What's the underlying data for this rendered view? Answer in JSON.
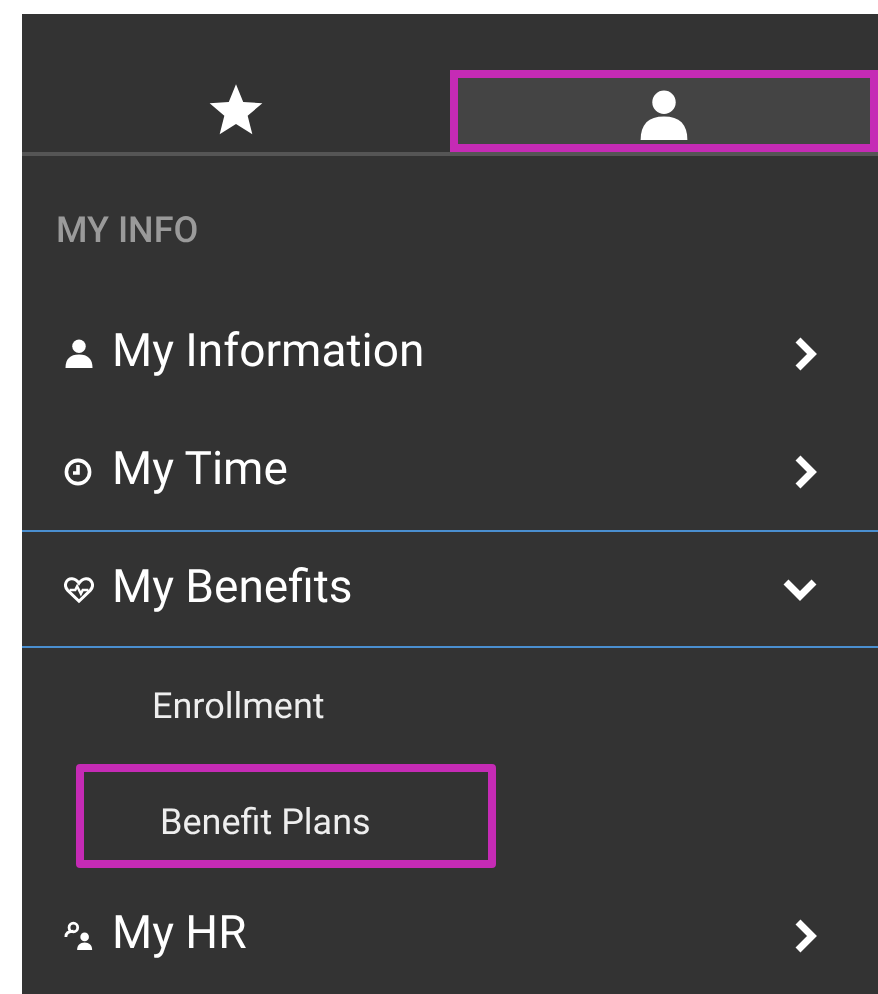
{
  "tabs": [
    {
      "kind": "star",
      "selected": false,
      "highlighted": false
    },
    {
      "kind": "person",
      "selected": true,
      "highlighted": true
    }
  ],
  "section_title": "MY INFO",
  "menu": [
    {
      "label": "My Information",
      "kind": "person",
      "expanded": false
    },
    {
      "label": "My Time",
      "kind": "clock",
      "expanded": false
    },
    {
      "label": "My Benefits",
      "kind": "heart",
      "expanded": true,
      "children": [
        {
          "label": "Enrollment",
          "highlighted": false
        },
        {
          "label": "Benefit Plans",
          "highlighted": true
        }
      ]
    },
    {
      "label": "My HR",
      "kind": "people",
      "expanded": false
    }
  ]
}
